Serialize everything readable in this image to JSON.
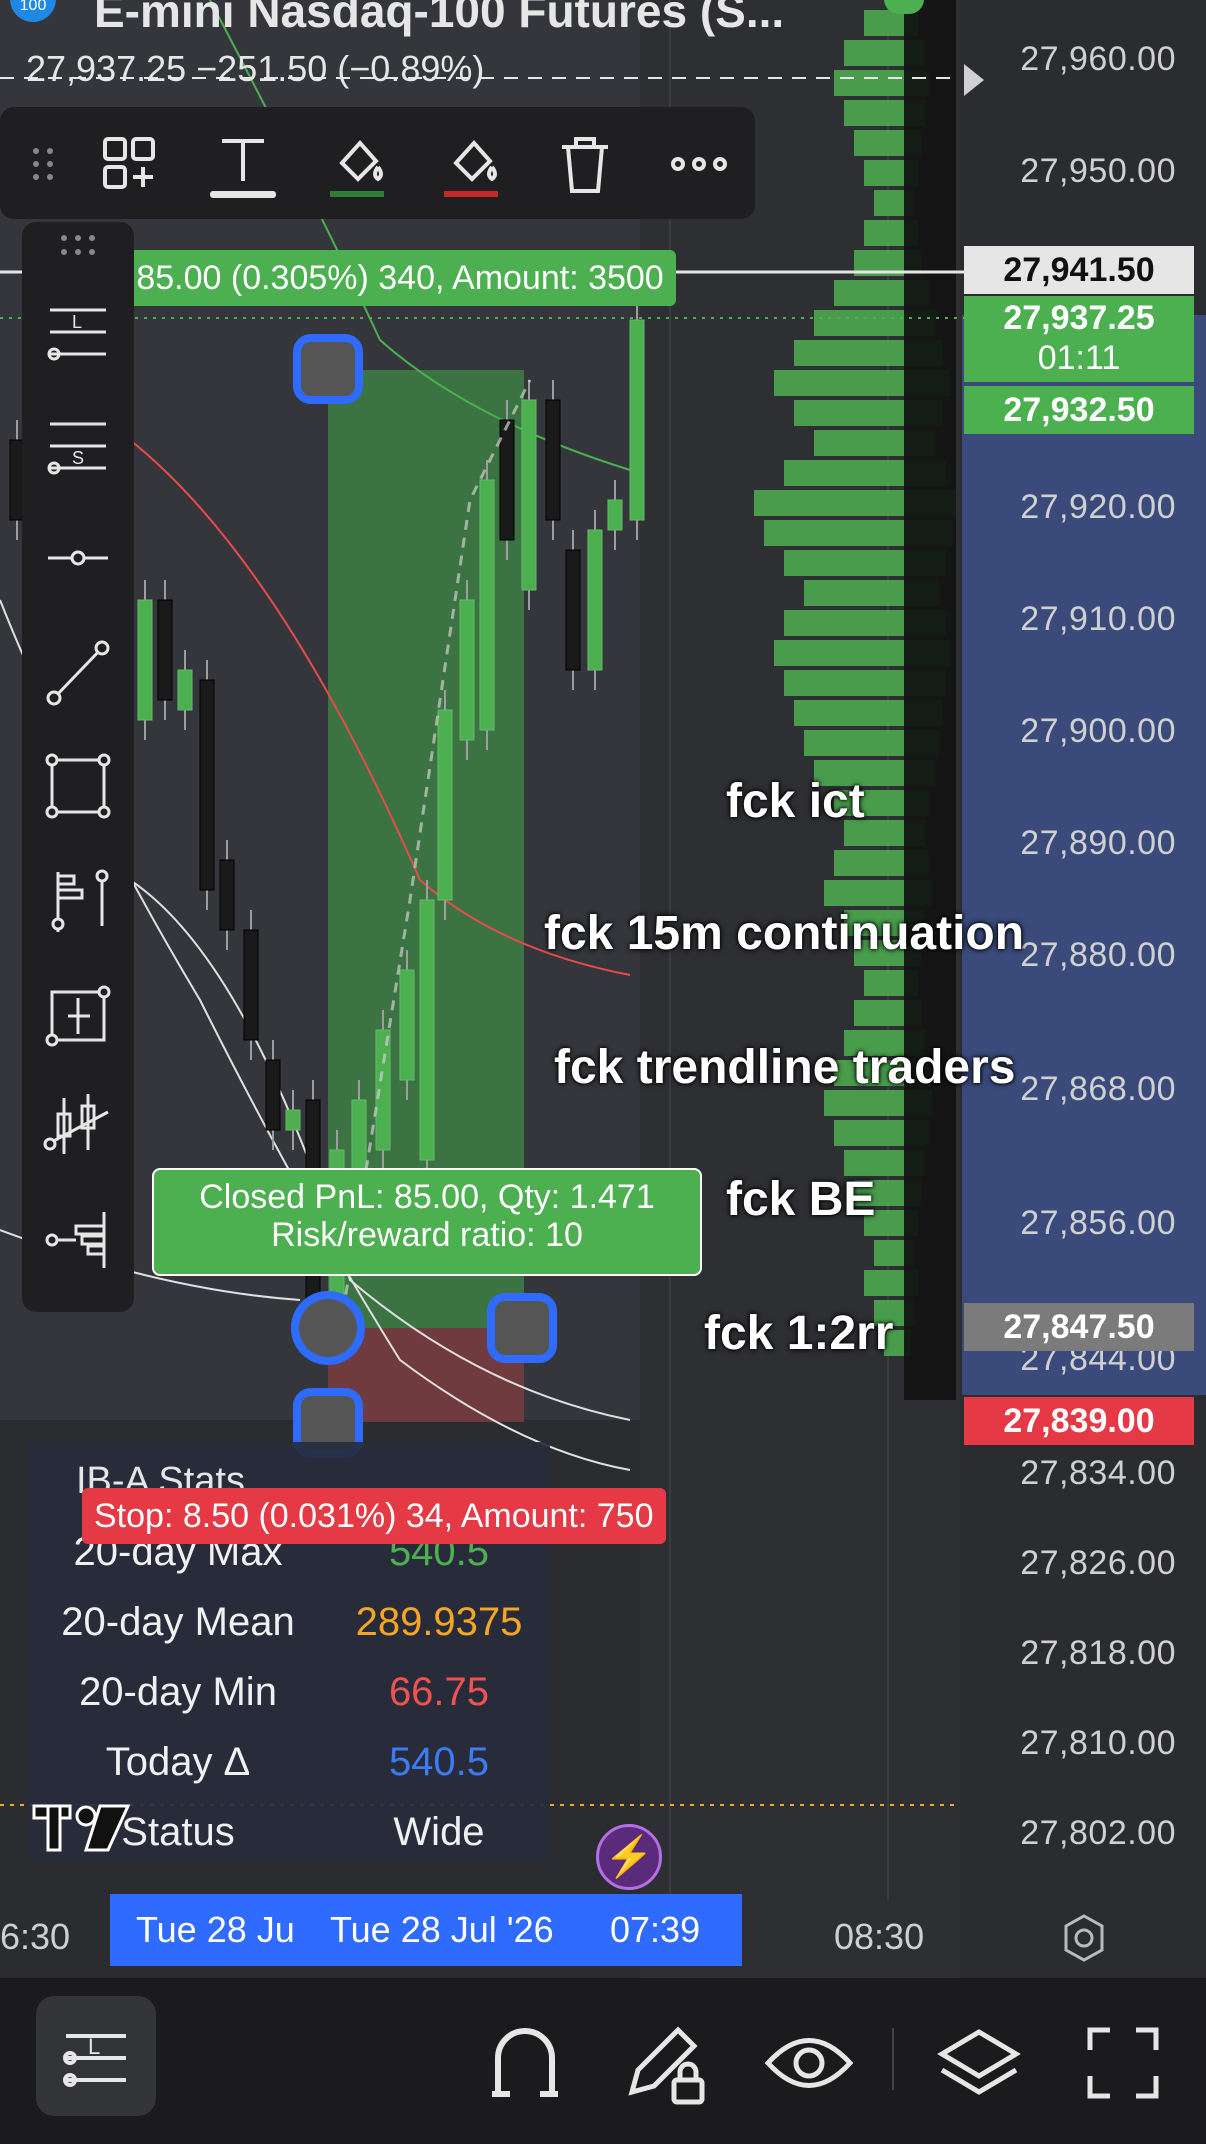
{
  "header": {
    "symbol_title": "E-mini Nasdaq-100 Futures (S...",
    "price_change": "27,937.25 −251.50 (−0.89%)",
    "symbol_badge": "100"
  },
  "price_axis": {
    "labels": [
      "27,960.00",
      "27,950.00",
      "27,920.00",
      "27,910.00",
      "27,900.00",
      "27,890.00",
      "27,880.00",
      "27,868.00",
      "27,856.00",
      "27,844.00",
      "27,834.00",
      "27,826.00",
      "27,818.00",
      "27,810.00",
      "27,802.00"
    ],
    "tags": {
      "crosshair": "27,941.50",
      "last_price": "27,937.25",
      "countdown": "01:11",
      "target": "27,932.50",
      "entry": "27,847.50",
      "stop": "27,839.00"
    }
  },
  "position_tool": {
    "target_label": "t: 85.00 (0.305%) 340, Amount: 3500",
    "closed_pnl": "Closed PnL: 85.00, Qty: 1.471",
    "rr_ratio": "Risk/reward ratio: 10",
    "stop_label": "Stop: 8.50 (0.031%) 34, Amount: 750"
  },
  "notes": [
    "fck ict",
    "fck 15m continuation",
    "fck trendline traders",
    "fck BE",
    "fck 1:2rr"
  ],
  "stats_panel": {
    "title": "IB-A Stats",
    "rows": [
      {
        "key": "20-day Max",
        "value": "540.5",
        "color": "#4caf50"
      },
      {
        "key": "20-day Mean",
        "value": "289.9375",
        "color": "#f5a623"
      },
      {
        "key": "20-day Min",
        "value": "66.75",
        "color": "#ef5350"
      },
      {
        "key": "Today Δ",
        "value": "540.5",
        "color": "#3d7bf5"
      },
      {
        "key": "Status",
        "value": "Wide",
        "color": "#f0f0f0"
      }
    ]
  },
  "time_axis": {
    "left": "6:30",
    "selected_short": "Tue 28 Ju",
    "selected_full": "Tue 28 Jul '26",
    "selected_time": "07:39",
    "right": "08:30"
  },
  "drawing_toolbar": {
    "items": [
      "drag-handle-icon",
      "add-to-favorites-icon",
      "text-icon",
      "fill-color-icon",
      "line-color-icon",
      "trash-icon",
      "more-icon"
    ]
  },
  "left_toolbar": {
    "items": [
      "long-position-icon",
      "short-position-icon",
      "horizontal-ray-icon",
      "trend-line-icon",
      "rectangle-icon",
      "anchored-vwap-icon",
      "fixed-range-volume-icon",
      "pitchfork-icon",
      "volume-profile-icon"
    ]
  },
  "bottom_bar": {
    "items": [
      "drawing-tools-icon",
      "magnet-icon",
      "lock-drawing-icon",
      "eye-icon",
      "layers-icon",
      "fullscreen-icon"
    ]
  },
  "colors": {
    "green": "#4caf50",
    "red": "#e53945",
    "blue": "#2f6bff",
    "panel": "#1f1f21"
  }
}
